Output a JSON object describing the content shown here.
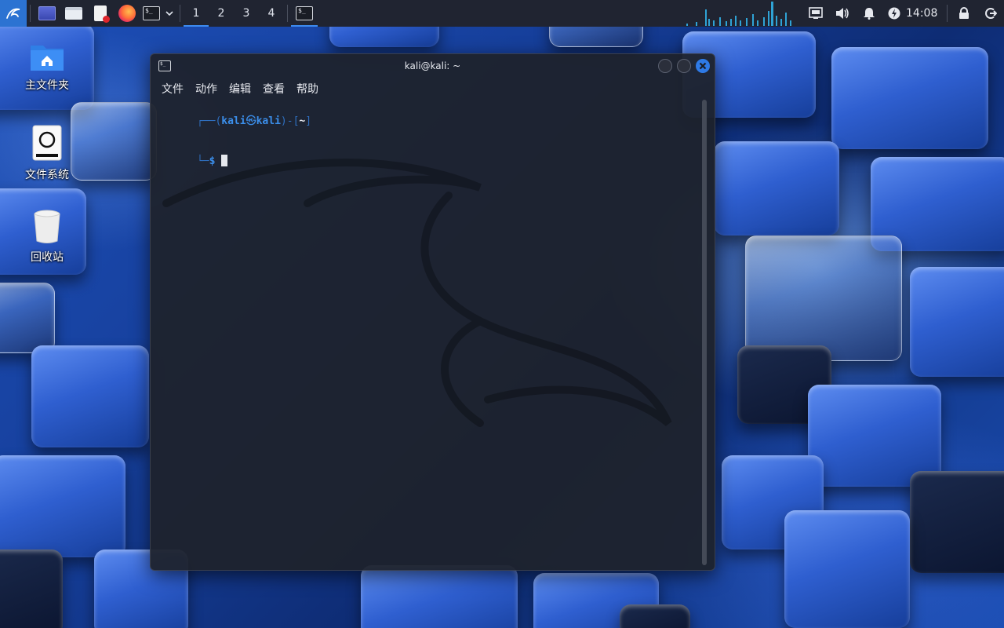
{
  "top_panel": {
    "workspaces": [
      "1",
      "2",
      "3",
      "4"
    ],
    "active_workspace": "1",
    "clock": "14:08",
    "icons": [
      "kali-menu-icon",
      "desktop-icon",
      "file-manager-icon",
      "text-editor-icon",
      "firefox-icon",
      "terminal-launcher-icon",
      "chevron-down-icon",
      "terminal-task-icon",
      "network-icon",
      "volume-icon",
      "bell-icon",
      "power-manager-icon",
      "lock-icon",
      "logout-icon"
    ]
  },
  "desktop": {
    "icons": [
      {
        "label": "主文件夹",
        "icon": "home-folder-icon"
      },
      {
        "label": "文件系统",
        "icon": "filesystem-icon"
      },
      {
        "label": "回收站",
        "icon": "trash-icon"
      }
    ]
  },
  "terminal": {
    "title": "kali@kali: ~",
    "menu": [
      "文件",
      "动作",
      "编辑",
      "查看",
      "帮助"
    ],
    "prompt": {
      "line1_prefix": "┌──(",
      "user": "kali",
      "at_symbol": "㉿",
      "host": "kali",
      "mid": ")-[",
      "path": "~",
      "suffix": "]",
      "line2_prefix": "└─",
      "dollar": "$"
    }
  },
  "colors": {
    "panel_bg": "#202431",
    "accent": "#3d8bf0",
    "terminal_bg": "#1e222c",
    "prompt_blue": "#3b8eea"
  }
}
